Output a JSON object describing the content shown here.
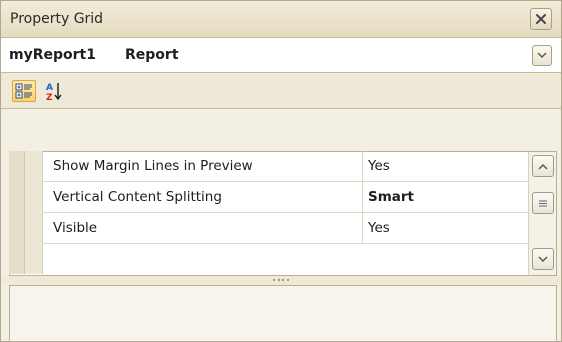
{
  "window": {
    "title": "Property Grid"
  },
  "selector": {
    "object_name": "myReport1",
    "object_type": "Report"
  },
  "toolbar": {
    "categorized_icon": "categorized-icon",
    "alphabetical_icon": "sort-az-icon"
  },
  "grid": {
    "rows": [
      {
        "name": "Show Margin Lines in Preview",
        "value": "Yes",
        "bold": false
      },
      {
        "name": "Vertical Content Splitting",
        "value": "Smart",
        "bold": true
      },
      {
        "name": "Visible",
        "value": "Yes",
        "bold": false
      }
    ]
  },
  "description": {
    "text": ""
  },
  "colors": {
    "accent": "#ffd26a",
    "frame": "#f3efe2",
    "border": "#b2a98c"
  }
}
